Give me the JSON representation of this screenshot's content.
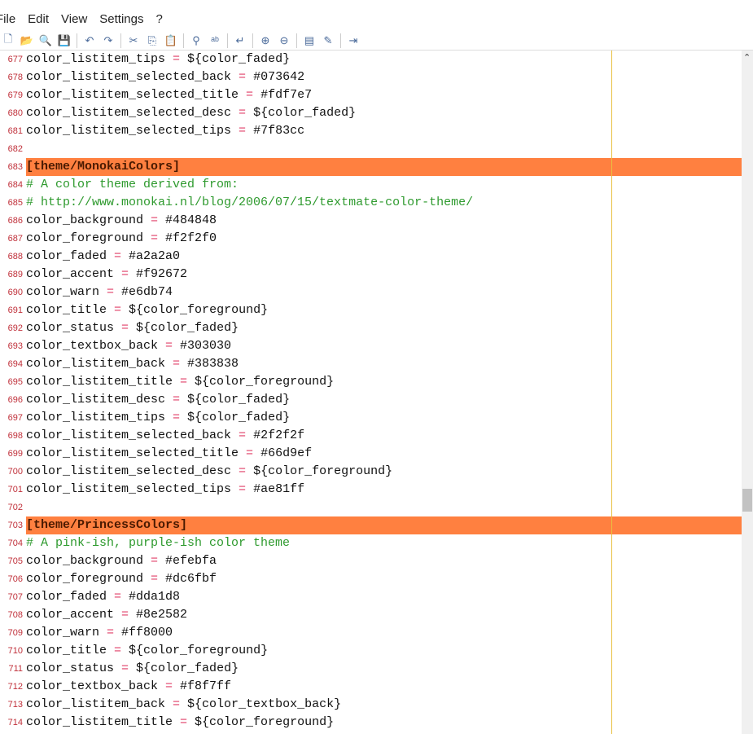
{
  "menu": [
    "File",
    "Edit",
    "View",
    "Settings",
    "?"
  ],
  "toolbar": [
    "new-icon",
    "open-icon",
    "browse-icon",
    "save-icon",
    "|",
    "undo-icon",
    "redo-icon",
    "|",
    "cut-icon",
    "copy-icon",
    "paste-icon",
    "|",
    "find-icon",
    "replace-icon",
    "|",
    "word-wrap-icon",
    "|",
    "zoom-in-icon",
    "zoom-out-icon",
    "|",
    "scheme-icon",
    "customize-scheme-icon",
    "|",
    "exit-icon"
  ],
  "lines": [
    {
      "n": "677",
      "key": "color_listitem_tips",
      "value": "${color_faded}"
    },
    {
      "n": "678",
      "key": "color_listitem_selected_back",
      "value": "#073642"
    },
    {
      "n": "679",
      "key": "color_listitem_selected_title",
      "value": "#fdf7e7"
    },
    {
      "n": "680",
      "key": "color_listitem_selected_desc",
      "value": "${color_faded}"
    },
    {
      "n": "681",
      "key": "color_listitem_selected_tips",
      "value": "#7f83cc"
    },
    {
      "n": "682"
    },
    {
      "n": "683",
      "section": "[theme/MonokaiColors]"
    },
    {
      "n": "684",
      "comment": "# A color theme derived from:"
    },
    {
      "n": "685",
      "comment": "# http://www.monokai.nl/blog/2006/07/15/textmate-color-theme/"
    },
    {
      "n": "686",
      "key": "color_background",
      "value": "#484848"
    },
    {
      "n": "687",
      "key": "color_foreground",
      "value": "#f2f2f0"
    },
    {
      "n": "688",
      "key": "color_faded",
      "value": "#a2a2a0"
    },
    {
      "n": "689",
      "key": "color_accent",
      "value": "#f92672"
    },
    {
      "n": "690",
      "key": "color_warn",
      "value": "#e6db74"
    },
    {
      "n": "691",
      "key": "color_title",
      "value": "${color_foreground}"
    },
    {
      "n": "692",
      "key": "color_status",
      "value": "${color_faded}"
    },
    {
      "n": "693",
      "key": "color_textbox_back",
      "value": "#303030"
    },
    {
      "n": "694",
      "key": "color_listitem_back",
      "value": "#383838"
    },
    {
      "n": "695",
      "key": "color_listitem_title",
      "value": "${color_foreground}"
    },
    {
      "n": "696",
      "key": "color_listitem_desc",
      "value": "${color_faded}"
    },
    {
      "n": "697",
      "key": "color_listitem_tips",
      "value": "${color_faded}"
    },
    {
      "n": "698",
      "key": "color_listitem_selected_back",
      "value": "#2f2f2f"
    },
    {
      "n": "699",
      "key": "color_listitem_selected_title",
      "value": "#66d9ef"
    },
    {
      "n": "700",
      "key": "color_listitem_selected_desc",
      "value": "${color_foreground}"
    },
    {
      "n": "701",
      "key": "color_listitem_selected_tips",
      "value": "#ae81ff"
    },
    {
      "n": "702"
    },
    {
      "n": "703",
      "section": "[theme/PrincessColors]"
    },
    {
      "n": "704",
      "comment": "# A pink-ish, purple-ish color theme"
    },
    {
      "n": "705",
      "key": "color_background",
      "value": "#efebfa"
    },
    {
      "n": "706",
      "key": "color_foreground",
      "value": "#dc6fbf"
    },
    {
      "n": "707",
      "key": "color_faded",
      "value": "#dda1d8"
    },
    {
      "n": "708",
      "key": "color_accent",
      "value": "#8e2582"
    },
    {
      "n": "709",
      "key": "color_warn",
      "value": "#ff8000"
    },
    {
      "n": "710",
      "key": "color_title",
      "value": "${color_foreground}"
    },
    {
      "n": "711",
      "key": "color_status",
      "value": "${color_faded}"
    },
    {
      "n": "712",
      "key": "color_textbox_back",
      "value": "#f8f7ff"
    },
    {
      "n": "713",
      "key": "color_listitem_back",
      "value": "${color_textbox_back}"
    },
    {
      "n": "714",
      "key": "color_listitem_title",
      "value": "${color_foreground}"
    }
  ],
  "equals": " = ",
  "scrollbar": {
    "position_fraction": 0.62
  }
}
